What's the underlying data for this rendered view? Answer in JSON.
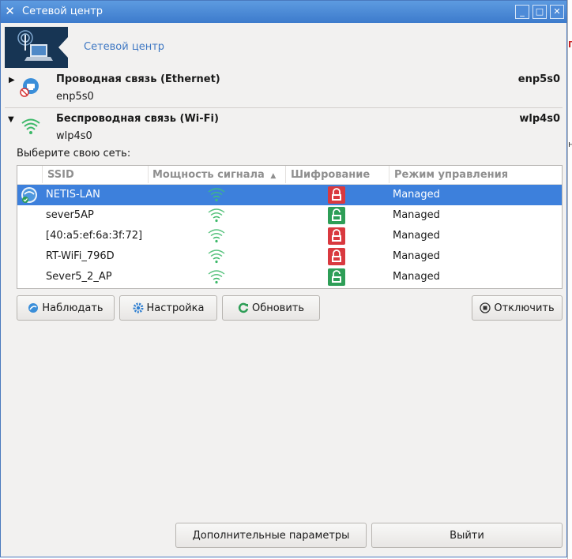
{
  "window": {
    "title": "Сетевой центр",
    "controls": [
      "minimize-icon",
      "maximize-icon",
      "close-icon"
    ]
  },
  "banner": {
    "label": "Сетевой центр"
  },
  "ethernet": {
    "title": "Проводная связь (Ethernet)",
    "subtitle": "enp5s0",
    "device": "enp5s0"
  },
  "wifi": {
    "title": "Беспроводная связь (Wi-Fi)",
    "subtitle": "wlp4s0",
    "device": "wlp4s0",
    "prompt": "Выберите свою сеть:"
  },
  "table": {
    "headers": {
      "ssid": "SSID",
      "signal": "Мощность сигнала",
      "encryption": "Шифрование",
      "mode": "Режим управления"
    },
    "sort_indicator": "▲",
    "rows": [
      {
        "ssid": "NETIS-LAN",
        "mode": "Managed",
        "encrypted": true,
        "connected": true,
        "signal_bars": 4
      },
      {
        "ssid": "sever5AP",
        "mode": "Managed",
        "encrypted": false,
        "connected": false,
        "signal_bars": 4
      },
      {
        "ssid": "[40:a5:ef:6a:3f:72]",
        "mode": "Managed",
        "encrypted": true,
        "connected": false,
        "signal_bars": 4
      },
      {
        "ssid": "RT-WiFi_796D",
        "mode": "Managed",
        "encrypted": true,
        "connected": false,
        "signal_bars": 4
      },
      {
        "ssid": "Sever5_2_AP",
        "mode": "Managed",
        "encrypted": false,
        "connected": false,
        "signal_bars": 4
      }
    ]
  },
  "actions": {
    "monitor": "Наблюдать",
    "configure": "Настройка",
    "refresh": "Обновить",
    "disconnect": "Отключить"
  },
  "footer": {
    "advanced": "Дополнительные параметры",
    "quit": "Выйти"
  },
  "colors": {
    "selection": "#3d80dc",
    "lock_closed": "#d9393f",
    "lock_open": "#2e9e57",
    "wifi_signal": "#3cb868",
    "link": "#3f78c3",
    "titlebar": "#4a88d6"
  }
}
